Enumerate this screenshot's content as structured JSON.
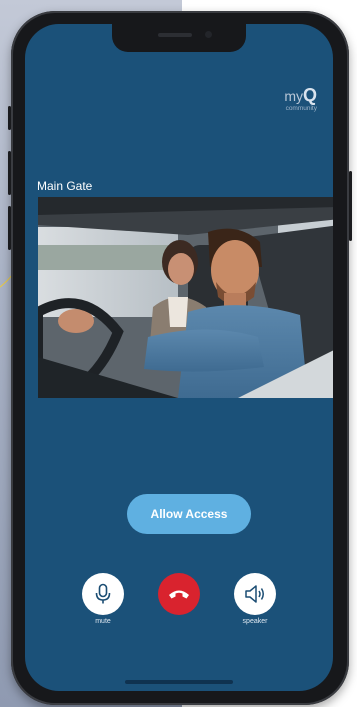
{
  "logo": {
    "my": "my",
    "q": "Q",
    "sub": "community"
  },
  "call": {
    "location": "Main Gate"
  },
  "actions": {
    "allow_label": "Allow Access"
  },
  "controls": {
    "mute_label": "mute",
    "speaker_label": "speaker"
  },
  "colors": {
    "screen_bg": "#1b5179",
    "allow_button": "#5fb0e1",
    "end_call": "#d9232e"
  }
}
